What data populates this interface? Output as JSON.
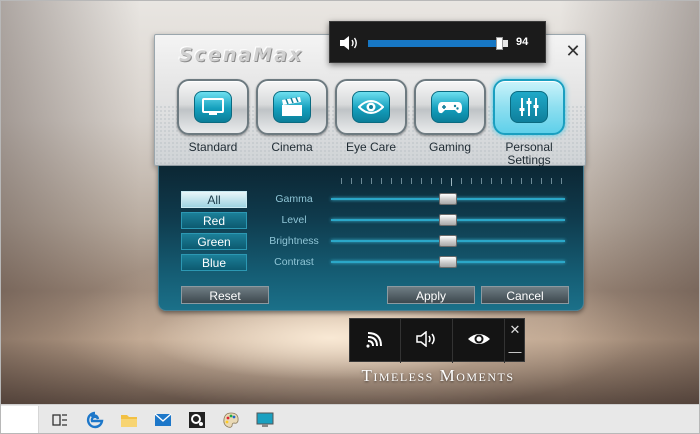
{
  "app": {
    "logo": "ScenaMax",
    "close_label": "✕",
    "modes": [
      {
        "label": "Standard",
        "icon": "monitor-icon",
        "active": false
      },
      {
        "label": "Cinema",
        "icon": "clapperboard-icon",
        "active": false
      },
      {
        "label": "Eye Care",
        "icon": "eye-icon",
        "active": false
      },
      {
        "label": "Gaming",
        "icon": "gamepad-icon",
        "active": false
      },
      {
        "label": "Personal Settings",
        "icon": "equalizer-icon",
        "active": true
      }
    ]
  },
  "volume": {
    "icon": "speaker-icon",
    "level": 94,
    "level_label": "94",
    "accent": "#1777c4"
  },
  "settings": {
    "channels": [
      "All",
      "Red",
      "Green",
      "Blue"
    ],
    "selected_channel": "All",
    "sliders": [
      {
        "label": "Gamma"
      },
      {
        "label": "Level"
      },
      {
        "label": "Brightness"
      },
      {
        "label": "Contrast"
      }
    ],
    "reset_label": "Reset",
    "apply_label": "Apply",
    "cancel_label": "Cancel"
  },
  "widget": {
    "items": [
      {
        "icon": "wifi-icon"
      },
      {
        "icon": "speaker-icon"
      },
      {
        "icon": "eye-icon"
      }
    ],
    "close_label": "✕",
    "minimize_label": "—"
  },
  "tagline": "Timeless Moments",
  "taskbar": {
    "icons": [
      "task-view-icon",
      "edge-icon",
      "file-explorer-icon",
      "mail-icon",
      "app-gear-icon",
      "paint-icon",
      "scenamax-icon"
    ]
  }
}
